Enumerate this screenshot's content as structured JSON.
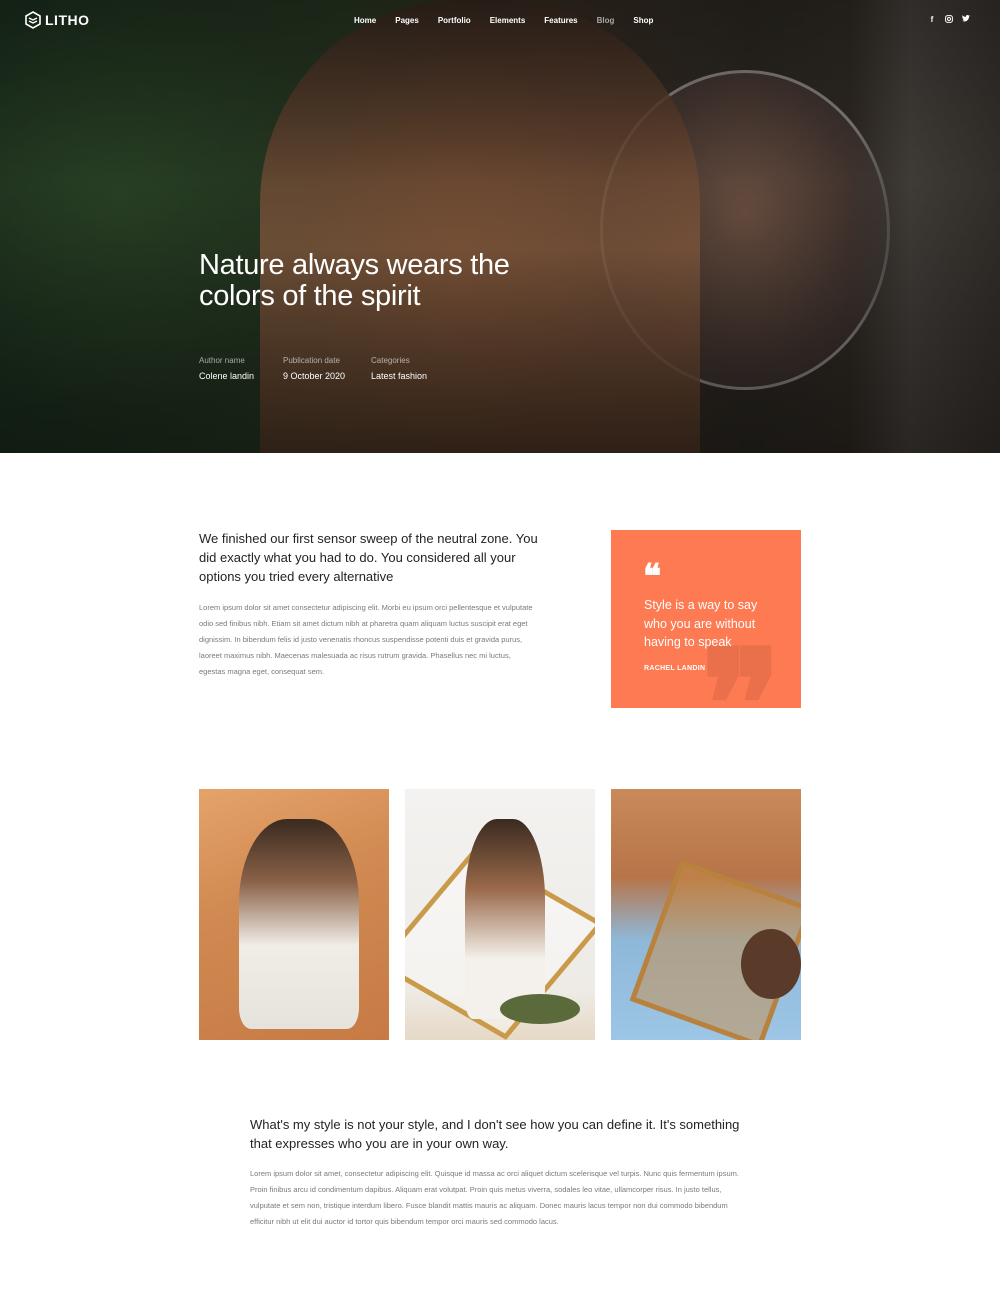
{
  "brand": {
    "name": "LITHO"
  },
  "nav": {
    "items": [
      {
        "label": "Home"
      },
      {
        "label": "Pages"
      },
      {
        "label": "Portfolio"
      },
      {
        "label": "Elements"
      },
      {
        "label": "Features"
      },
      {
        "label": "Blog"
      },
      {
        "label": "Shop"
      }
    ],
    "active": "Blog"
  },
  "social": {
    "facebook": "f",
    "instagram": "◎",
    "twitter": "🐦"
  },
  "hero": {
    "title": "Nature always wears the colors of the spirit",
    "meta": [
      {
        "key": "Author name",
        "value": "Colene landin"
      },
      {
        "key": "Publication date",
        "value": "9 October 2020"
      },
      {
        "key": "Categories",
        "value": "Latest fashion"
      }
    ]
  },
  "intro": {
    "lead": "We finished our first sensor sweep of the neutral zone. You did exactly what you had to do. You considered all your options you tried every alternative",
    "body": "Lorem ipsum dolor sit amet consectetur adipiscing elit. Morbi eu ipsum orci pellentesque et vulputate odio sed finibus nibh. Etiam sit amet dictum nibh at pharetra quam aliquam luctus suscipit erat eget dignissim. In bibendum felis id justo venenatis rhoncus suspendisse potenti duis et gravida purus, laoreet maximus nibh. Maecenas malesuada ac risus rutrum gravida. Phasellus nec mi luctus, egestas magna eget, consequat sem."
  },
  "quote": {
    "mark": "❝",
    "text": "Style is a way to say who you are without having to speak",
    "author": "RACHEL LANDIN",
    "color": "#fd7a52"
  },
  "gallery": {
    "images": [
      {
        "alt": "man-in-desert-photo"
      },
      {
        "alt": "man-with-frame-photo"
      },
      {
        "alt": "man-with-mirror-photo"
      }
    ]
  },
  "closing": {
    "lead": "What's my style is not your style, and I don't see how you can define it. It's something that expresses who you are in your own way.",
    "body": "Lorem ipsum dolor sit amet, consectetur adipiscing elit. Quisque id massa ac orci aliquet dictum scelerisque vel turpis. Nunc quis fermentum ipsum. Proin finibus arcu id condimentum dapibus. Aliquam erat volutpat. Proin quis metus viverra, sodales leo vitae, ullamcorper risus. In justo tellus, vulputate et sem non, tristique interdum libero. Fusce blandit mattis mauris ac aliquam. Donec mauris lacus tempor non dui commodo bibendum efficitur nibh ut elit dui auctor id tortor quis bibendum tempor orci mauris sed commodo lacus."
  }
}
